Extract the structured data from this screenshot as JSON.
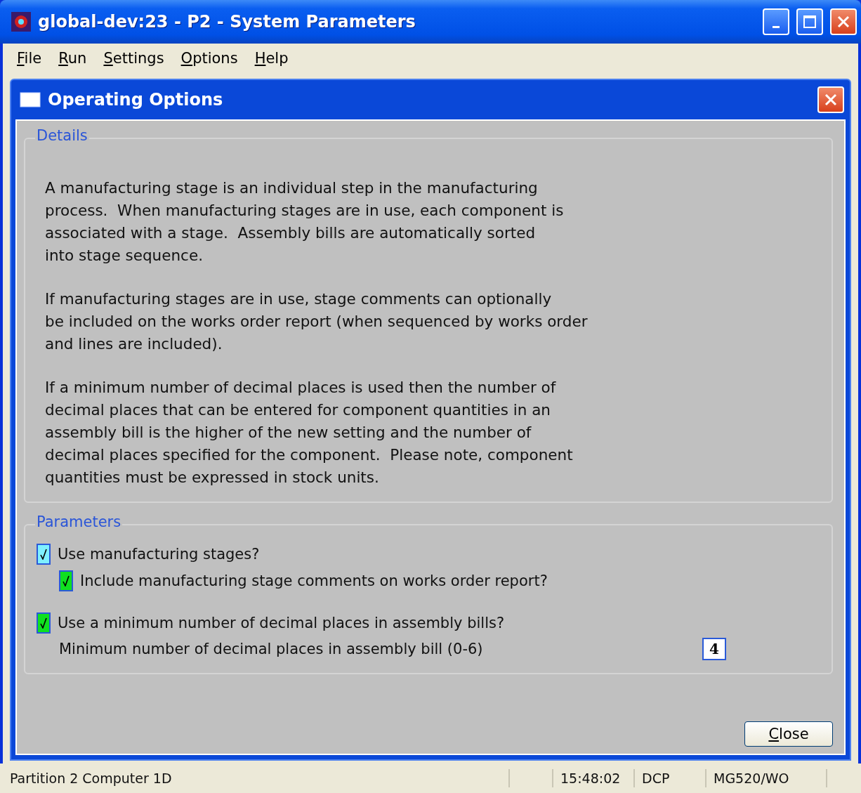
{
  "window": {
    "title": "global-dev:23 - P2 - System Parameters"
  },
  "menu": [
    "File",
    "Run",
    "Settings",
    "Options",
    "Help"
  ],
  "dialog": {
    "title": "Operating Options"
  },
  "details": {
    "legend": "Details",
    "paragraphs": [
      "A manufacturing stage is an individual step in the manufacturing\nprocess.  When manufacturing stages are in use, each component is\nassociated with a stage.  Assembly bills are automatically sorted\ninto stage sequence.",
      "If manufacturing stages are in use, stage comments can optionally\nbe included on the works order report (when sequenced by works order\nand lines are included).",
      "If a minimum number of decimal places is used then the number of\ndecimal places that can be entered for component quantities in an\nassembly bill is the higher of the new setting and the number of\ndecimal places specified for the component.  Please note, component\nquantities must be expressed in stock units."
    ]
  },
  "parameters": {
    "legend": "Parameters",
    "options": [
      {
        "label": "Use manufacturing stages?",
        "checked": true,
        "focused": true,
        "children": [
          {
            "label": "Include manufacturing stage comments on works order report?",
            "checked": true,
            "focused": false
          }
        ]
      },
      {
        "label": "Use a minimum number of decimal places in assembly bills?",
        "checked": true,
        "focused": false
      }
    ],
    "field": {
      "label": "Minimum number of decimal places in assembly bill (0-6)",
      "value": "4"
    }
  },
  "buttons": [
    "Close"
  ],
  "status_bar": [
    "Partition 2 Computer 1D",
    "15:48:02",
    "DCP",
    "MG520/WO"
  ]
}
